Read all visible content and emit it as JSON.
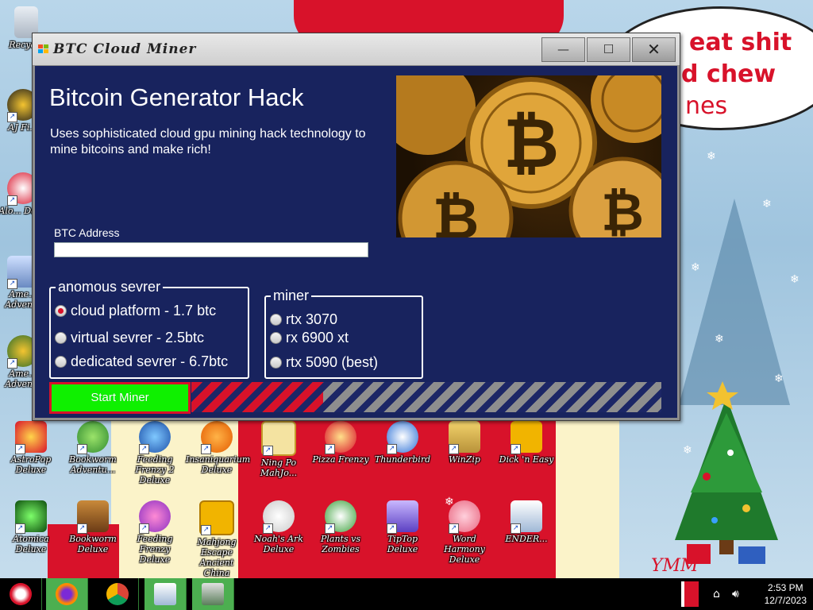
{
  "window": {
    "title": "BTC Cloud Miner",
    "controls": {
      "minimize": "—",
      "maximize": "☐",
      "close": "✕"
    }
  },
  "app": {
    "heading": "Bitcoin Generator Hack",
    "description": "Uses sophisticated cloud gpu mining hack technology to mine bitcoins and make rich!",
    "btc_address_label": "BTC Address",
    "btc_address_value": "",
    "server_group": {
      "title": "anomous sevrer",
      "options": [
        {
          "label": "cloud platform - 1.7 btc",
          "checked": true
        },
        {
          "label": "virtual sevrer - 2.5btc",
          "checked": false
        },
        {
          "label": "dedicated sevrer - 6.7btc",
          "checked": false
        }
      ]
    },
    "miner_group": {
      "title": "miner",
      "options": [
        {
          "label": "rtx 3070",
          "checked": false
        },
        {
          "label": "rx 6900 xt",
          "checked": false
        },
        {
          "label": "rtx 5090 (best)",
          "checked": false
        }
      ]
    },
    "start_button": "Start Miner",
    "progress_fraction": 0.28
  },
  "desktop": {
    "speech_lines": [
      "eat shit",
      "d chew",
      "nes"
    ],
    "watermark": "YMM",
    "icons_row1": [
      "AstroPop Deluxe",
      "Bookworm Adventu...",
      "Feeding Frenzy 2 Deluxe",
      "Insaniquarium Deluxe",
      "Ning Po MahJo...",
      "Pizza Frenzy",
      "Thunderbird",
      "WinZip",
      "Dick 'n Easy"
    ],
    "icons_row2": [
      "Atomica Deluxe",
      "Bookworm Deluxe",
      "Feeding Frenzy Deluxe",
      "Mahjong Escape Ancient China",
      "Noah's Ark Deluxe",
      "Plants vs Zombies",
      "TipTop Deluxe",
      "Word Harmony Deluxe",
      "ENDER..."
    ],
    "icons_left": [
      "Recycle",
      "AJ Fi...",
      "Alo... Del...",
      "Ame... Adven...",
      "Ame... Adven..."
    ]
  },
  "taskbar": {
    "time": "2:53 PM",
    "date": "12/7/2023"
  },
  "colors": {
    "client_bg": "#18235e",
    "start_button": "#0ff000",
    "accent_red": "#d8122a"
  }
}
